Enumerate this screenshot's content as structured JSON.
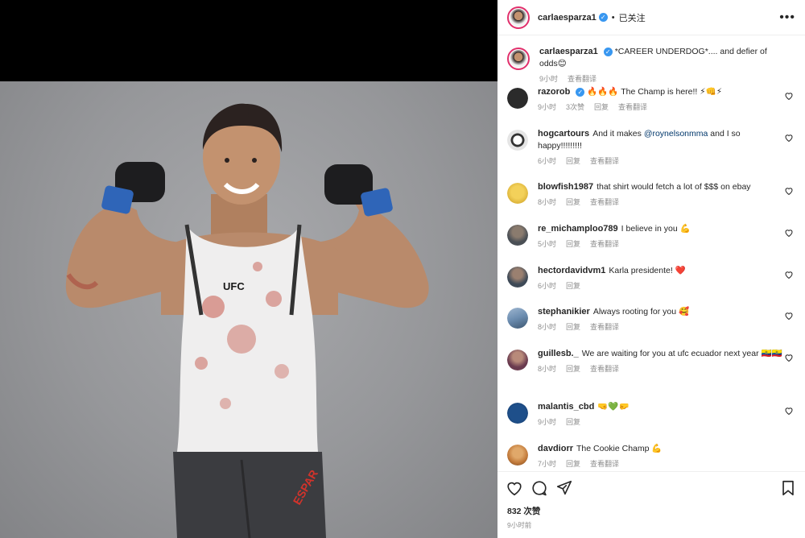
{
  "post": {
    "author": "carlaesparza1",
    "follow_label": "已关注",
    "caption_user": "carlaesparza1",
    "caption": "*CAREER UNDERDOG*.... and defier of odds😊",
    "caption_time": "9小时",
    "translate_label": "查看翻译",
    "likes": "832 次赞",
    "posted_time": "9小时前"
  },
  "media": {
    "shirt_text": "UFC",
    "shorts_text": "ESPAR"
  },
  "comments": [
    {
      "user": "razorob",
      "verified": true,
      "text": "🔥🔥🔥 The Champ is here!! ⚡👊⚡",
      "time": "9小时",
      "likes": "3次赞",
      "reply": "回复",
      "translate": "查看翻译",
      "avatar_color": "#2b2b2b"
    },
    {
      "user": "hogcartours",
      "text_before": "And it makes ",
      "mention": "@roynelsonmma",
      "text_after": " and I so happy!!!!!!!!!",
      "time": "6小时",
      "reply": "回复",
      "translate": "查看翻译",
      "avatar_color": "#d9d9d9"
    },
    {
      "user": "blowfish1987",
      "text": "that shirt would fetch a lot of $$$ on ebay",
      "time": "8小时",
      "reply": "回复",
      "translate": "查看翻译",
      "avatar_color": "#e3c248"
    },
    {
      "user": "re_michamploo789",
      "text": "I believe in you 💪",
      "time": "5小时",
      "reply": "回复",
      "translate": "查看翻译",
      "avatar_color": "#5a5f66"
    },
    {
      "user": "hectordavidvm1",
      "text": "Karla presidente! ❤️",
      "time": "6小时",
      "reply": "回复",
      "avatar_color": "#3e4a57"
    },
    {
      "user": "stephanikier",
      "text": "Always rooting for you 🥰",
      "time": "8小时",
      "reply": "回复",
      "translate": "查看翻译",
      "avatar_color": "#6b8caf"
    },
    {
      "user": "guillesb._",
      "text": "We are waiting for you at ufc ecuador next year 🇪🇨🇪🇨",
      "time": "8小时",
      "reply": "回复",
      "translate": "查看翻译",
      "avatar_color": "#6a3b4f"
    },
    {
      "user": "malantis_cbd",
      "text": "🤜💚🤛",
      "time": "9小时",
      "reply": "回复",
      "avatar_color": "#1e4f8a"
    },
    {
      "user": "davdiorr",
      "text": "The Cookie Champ 💪",
      "time": "7小时",
      "reply": "回复",
      "translate": "查看翻译",
      "avatar_color": "#c27a3a"
    }
  ],
  "icons": {
    "like": "heart-icon",
    "comment": "comment-icon",
    "share": "share-icon",
    "save": "bookmark-icon",
    "more": "more-icon"
  },
  "colors": {
    "accent": "#3897f0",
    "ring": "#e1306c",
    "background": "#ffffff"
  }
}
